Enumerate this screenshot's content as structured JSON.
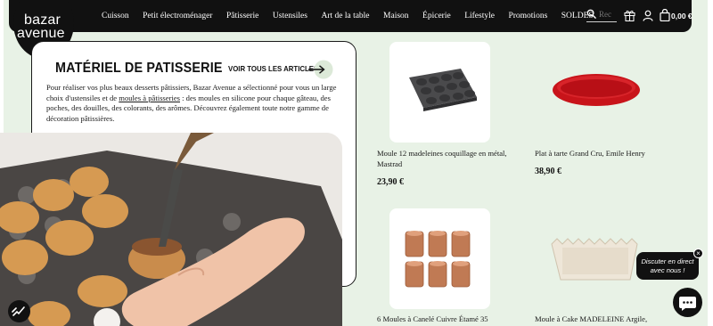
{
  "logo": {
    "line1": "bazar",
    "line2": "avenue"
  },
  "nav": {
    "items": [
      "Cuisson",
      "Petit électroménager",
      "Pâtisserie",
      "Ustensiles",
      "Art de la table",
      "Maison",
      "Épicerie",
      "Lifestyle",
      "Promotions",
      "SOLDES"
    ],
    "search_placeholder": "Rec",
    "cart_amount": "0,00 €"
  },
  "category": {
    "title": "MATÉRIEL DE PATISSERIE",
    "see_all": "VOIR TOUS LES ARTICLES",
    "desc_before": "Pour réaliser vos plus beaux desserts pâtissiers, Bazar Avenue a sélectionné pour vous un large choix d'ustensiles et de ",
    "desc_link": "moules à pâtisseries",
    "desc_after": " : des moules en silicone pour chaque gâteau, des poches, des douilles, des colorants, des arômes. Découvrez également toute notre gamme de décoration pâtissières."
  },
  "products": [
    {
      "name": "Moule 12 madeleines coquillage en métal, Mastrad",
      "price": "23,90 €"
    },
    {
      "name": "Plat à tarte Grand Cru, Emile Henry",
      "price": "38,90 €"
    },
    {
      "name": "6 Moules à Canelé Cuivre Étamé 35",
      "price": ""
    },
    {
      "name": "Moule à Cake MADELEINE Argile,",
      "price": ""
    }
  ],
  "chat": {
    "line1": "Discuter en direct",
    "line2": "avec nous !",
    "close": "×"
  },
  "colors": {
    "background": "#e8f2e6",
    "nav": "#111111",
    "tart_red": "#c8141a",
    "copper": "#c07a54"
  },
  "icons": [
    "search-icon",
    "gift-icon",
    "user-icon",
    "cart-icon",
    "arrow-right-icon",
    "chat-icon",
    "accessibility-icon"
  ]
}
